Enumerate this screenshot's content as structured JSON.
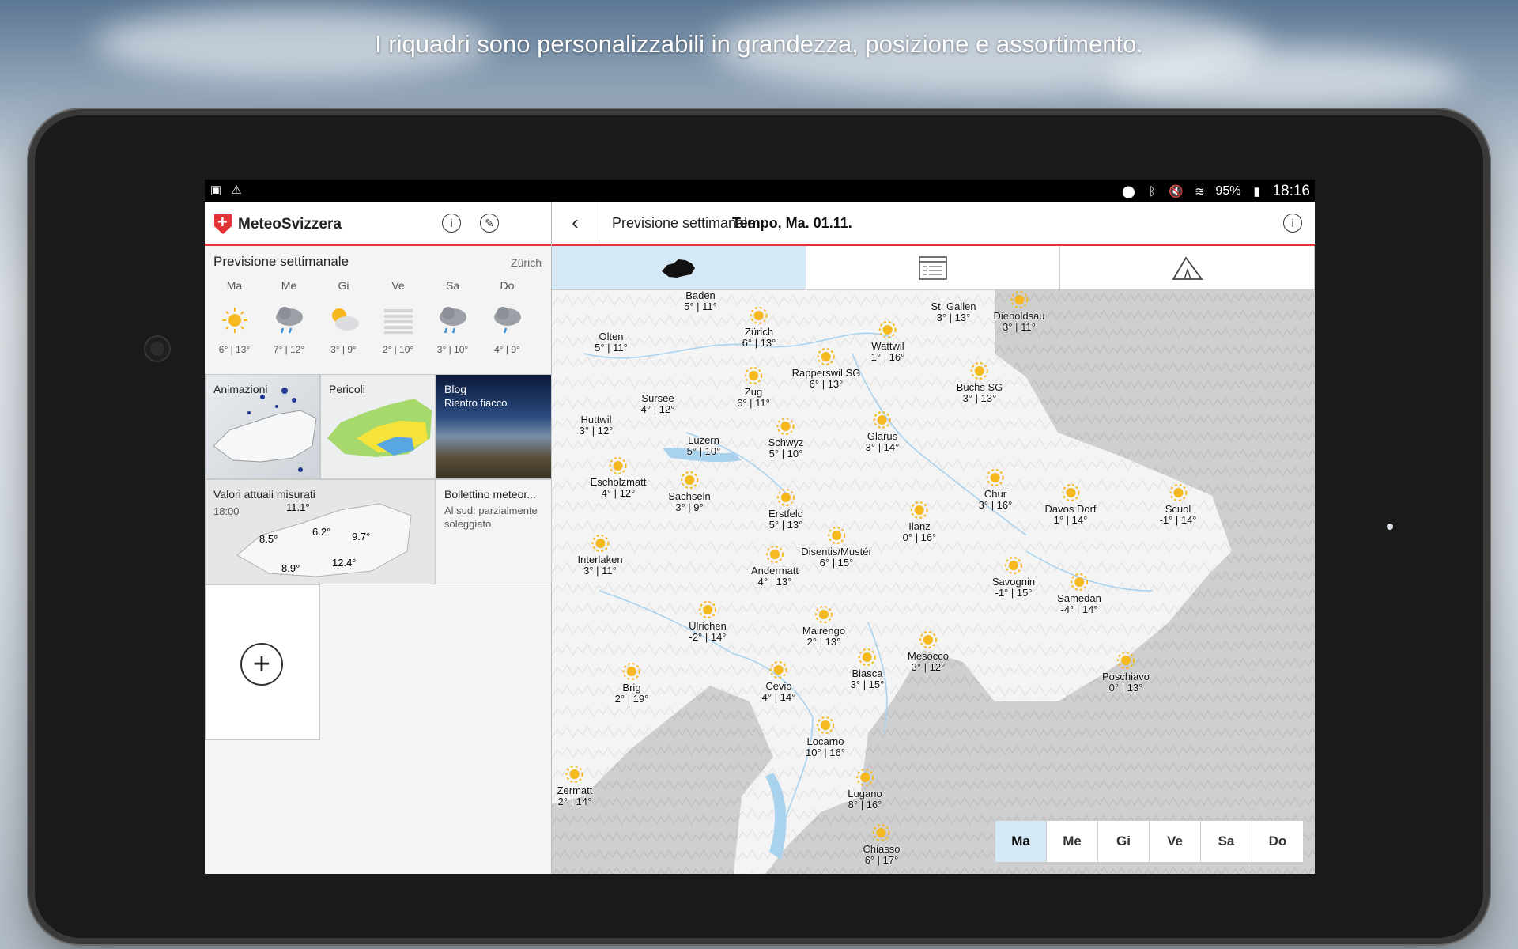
{
  "tagline": "I riquadri sono personalizzabili in grandezza, posizione e assortimento.",
  "statusbar": {
    "battery": "95%",
    "time": "18:16",
    "icons": [
      "image-icon",
      "warning-icon",
      "location-icon",
      "bluetooth-icon",
      "mute-icon",
      "wifi-icon",
      "battery-icon"
    ]
  },
  "app": {
    "brand": "MeteoSvizzera",
    "accent": "#e53236",
    "highlight": "#d5e9f7"
  },
  "weekly": {
    "title": "Previsione settimanale",
    "location": "Zürich",
    "days": [
      {
        "day": "Ma",
        "icon": "sun-icon",
        "temp": "6° | 13°"
      },
      {
        "day": "Me",
        "icon": "rain-cloud-icon",
        "temp": "7° | 12°"
      },
      {
        "day": "Gi",
        "icon": "partly-sunny-icon",
        "temp": "3° | 9°"
      },
      {
        "day": "Ve",
        "icon": "fog-icon",
        "temp": "2° | 10°"
      },
      {
        "day": "Sa",
        "icon": "rain-cloud-icon",
        "temp": "3° | 10°"
      },
      {
        "day": "Do",
        "icon": "rain-cloud-icon",
        "temp": "4° | 9°"
      }
    ]
  },
  "tiles": {
    "animations": "Animazioni",
    "dangers": "Pericoli",
    "blog": {
      "title": "Blog",
      "sub": "Rientro fiacco"
    },
    "measured": {
      "title": "Valori attuali misurati",
      "time": "18:00",
      "values": [
        "11.1°",
        "6.2°",
        "9.7°",
        "8.5°",
        "12.4°",
        "8.9°"
      ]
    },
    "bulletin": {
      "title": "Bollettino meteor...",
      "body": "Al sud: parzialmente soleggiato"
    }
  },
  "right": {
    "title": "Previsione settimanale",
    "subtitle": "Tempo, Ma. 01.11.",
    "tabs": [
      "map-tab",
      "list-tab",
      "warning-tab"
    ],
    "days": [
      "Ma",
      "Me",
      "Gi",
      "Ve",
      "Sa",
      "Do"
    ],
    "active_day": "Ma"
  },
  "cities": [
    {
      "name": "Baden",
      "temp": "5° | 11°",
      "icon": "none"
    },
    {
      "name": "Zürich",
      "temp": "6° | 13°",
      "icon": "sun"
    },
    {
      "name": "St. Gallen",
      "temp": "3° | 13°",
      "icon": "none"
    },
    {
      "name": "Diepoldsau",
      "temp": "3° | 11°",
      "icon": "sun"
    },
    {
      "name": "Olten",
      "temp": "5° | 11°",
      "icon": "fog"
    },
    {
      "name": "Wattwil",
      "temp": "1° | 16°",
      "icon": "sun"
    },
    {
      "name": "Rapperswil SG",
      "temp": "6° | 13°",
      "icon": "sun"
    },
    {
      "name": "Zug",
      "temp": "6° | 11°",
      "icon": "sun"
    },
    {
      "name": "Buchs SG",
      "temp": "3° | 13°",
      "icon": "sun"
    },
    {
      "name": "Sursee",
      "temp": "4° | 12°",
      "icon": "fog"
    },
    {
      "name": "Huttwil",
      "temp": "3° | 12°",
      "icon": "fog"
    },
    {
      "name": "Luzern",
      "temp": "5° | 10°",
      "icon": "fog"
    },
    {
      "name": "Schwyz",
      "temp": "5° | 10°",
      "icon": "sun"
    },
    {
      "name": "Glarus",
      "temp": "3° | 14°",
      "icon": "sun"
    },
    {
      "name": "Escholzmatt",
      "temp": "4° | 12°",
      "icon": "sun"
    },
    {
      "name": "Sachseln",
      "temp": "3° | 9°",
      "icon": "sun"
    },
    {
      "name": "Erstfeld",
      "temp": "5° | 13°",
      "icon": "sun"
    },
    {
      "name": "Chur",
      "temp": "3° | 16°",
      "icon": "sun"
    },
    {
      "name": "Davos Dorf",
      "temp": "1° | 14°",
      "icon": "sun"
    },
    {
      "name": "Scuol",
      "temp": "-1° | 14°",
      "icon": "sun"
    },
    {
      "name": "Ilanz",
      "temp": "0° | 16°",
      "icon": "sun"
    },
    {
      "name": "Interlaken",
      "temp": "3° | 11°",
      "icon": "sun"
    },
    {
      "name": "Disentis/Mustér",
      "temp": "6° | 15°",
      "icon": "sun"
    },
    {
      "name": "Andermatt",
      "temp": "4° | 13°",
      "icon": "sun"
    },
    {
      "name": "Savognin",
      "temp": "-1° | 15°",
      "icon": "sun"
    },
    {
      "name": "Samedan",
      "temp": "-4° | 14°",
      "icon": "sun"
    },
    {
      "name": "Ulrichen",
      "temp": "-2° | 14°",
      "icon": "sun"
    },
    {
      "name": "Mairengo",
      "temp": "2° | 13°",
      "icon": "sun"
    },
    {
      "name": "Mesocco",
      "temp": "3° | 12°",
      "icon": "sun"
    },
    {
      "name": "Brig",
      "temp": "2° | 19°",
      "icon": "sun"
    },
    {
      "name": "Biasca",
      "temp": "3° | 15°",
      "icon": "sun"
    },
    {
      "name": "Cevio",
      "temp": "4° | 14°",
      "icon": "sun"
    },
    {
      "name": "Poschiavo",
      "temp": "0° | 13°",
      "icon": "sun"
    },
    {
      "name": "Locarno",
      "temp": "10° | 16°",
      "icon": "sun"
    },
    {
      "name": "Zermatt",
      "temp": "2° | 14°",
      "icon": "sun"
    },
    {
      "name": "Lugano",
      "temp": "8° | 16°",
      "icon": "sun"
    },
    {
      "name": "Chiasso",
      "temp": "6° | 17°",
      "icon": "sun"
    }
  ]
}
